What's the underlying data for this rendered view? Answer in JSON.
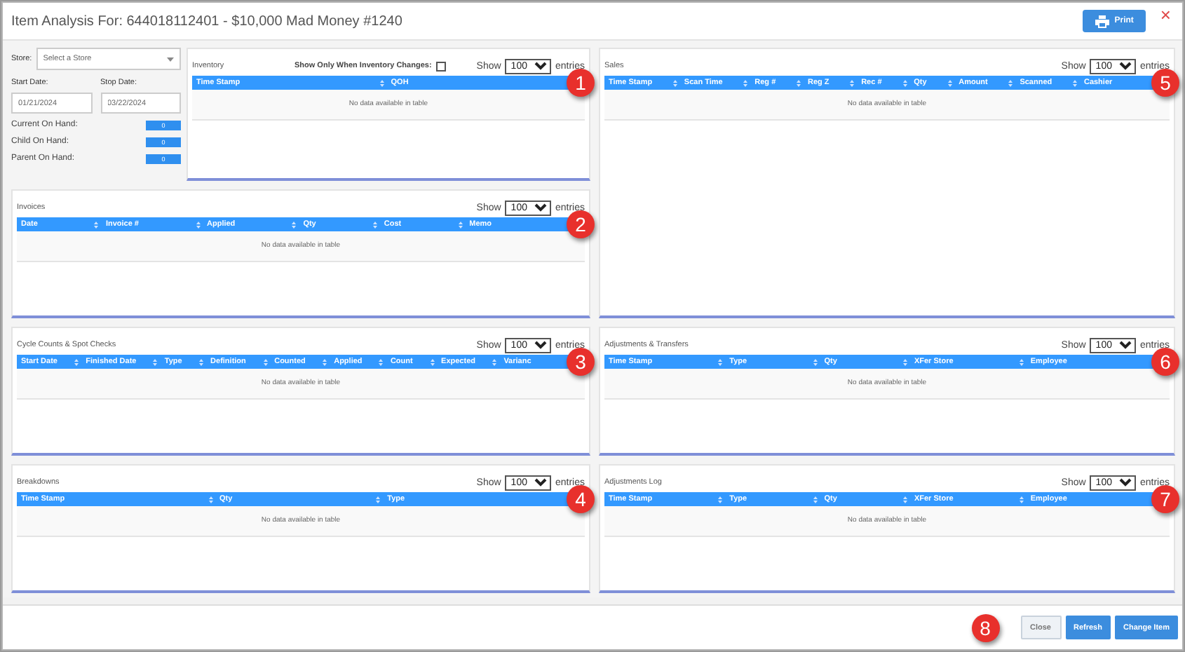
{
  "window": {
    "title": "Item Analysis For: 644018112401 - $10,000 Mad Money #1240",
    "print_button": "Print",
    "close": "×"
  },
  "filters": {
    "store": {
      "label": "Store:",
      "placeholder": "Select a Store"
    },
    "start_date": {
      "label": "Start Date:",
      "value": "01/21/2024"
    },
    "stop_date": {
      "label": "Stop Date:",
      "value": "03/22/2024"
    },
    "counters": [
      {
        "label": "Current On Hand:",
        "value": "0"
      },
      {
        "label": "Child On Hand:",
        "value": "0"
      },
      {
        "label": "Parent On Hand:",
        "value": "0"
      }
    ]
  },
  "inventory": {
    "title": "Inventory",
    "option": {
      "label": "Show Only When Inventory Changes:",
      "checked": false
    },
    "show_label": "Show",
    "page_size": "100",
    "entries_label": "entries",
    "columns": [
      "Time Stamp",
      "QOH"
    ],
    "empty_text": "No data available in table",
    "callout": "1"
  },
  "left_panels": [
    {
      "title": "Invoices",
      "show_label": "Show",
      "page_size": "100",
      "entries_label": "entries",
      "columns": [
        "Date",
        "Invoice #",
        "Applied",
        "Qty",
        "Cost",
        "Memo"
      ],
      "empty_text": "No data available in table",
      "callout": "2"
    },
    {
      "title": "Cycle Counts & Spot Checks",
      "show_label": "Show",
      "page_size": "100",
      "entries_label": "entries",
      "columns": [
        "Start Date",
        "Finished Date",
        "Type",
        "Definition",
        "Counted",
        "Applied",
        "Count",
        "Expected",
        "Varianc"
      ],
      "empty_text": "No data available in table",
      "callout": "3"
    },
    {
      "title": "Breakdowns",
      "show_label": "Show",
      "page_size": "100",
      "entries_label": "entries",
      "columns": [
        "Time Stamp",
        "Qty",
        "Type"
      ],
      "empty_text": "No data available in table",
      "callout": "4"
    }
  ],
  "right_panels": [
    {
      "title": "Sales",
      "show_label": "Show",
      "page_size": "100",
      "entries_label": "entries",
      "columns": [
        "Time Stamp",
        "Scan Time",
        "Reg #",
        "Reg Z",
        "Rec #",
        "Qty",
        "Amount",
        "Scanned",
        "Cashier"
      ],
      "empty_text": "No data available in table",
      "callout": "5"
    },
    {
      "title": "Adjustments & Transfers",
      "show_label": "Show",
      "page_size": "100",
      "entries_label": "entries",
      "columns": [
        "Time Stamp",
        "Type",
        "Qty",
        "XFer Store",
        "Employee"
      ],
      "empty_text": "No data available in table",
      "callout": "6"
    },
    {
      "title": "Adjustments Log",
      "show_label": "Show",
      "page_size": "100",
      "entries_label": "entries",
      "columns": [
        "Time Stamp",
        "Type",
        "Qty",
        "XFer Store",
        "Employee"
      ],
      "empty_text": "No data available in table",
      "callout": "7"
    }
  ],
  "footer": {
    "callout": "8",
    "buttons": [
      {
        "label": "Close",
        "kind": "secondary"
      },
      {
        "label": "Refresh",
        "kind": "primary"
      },
      {
        "label": "Change Item",
        "kind": "primary"
      }
    ]
  }
}
